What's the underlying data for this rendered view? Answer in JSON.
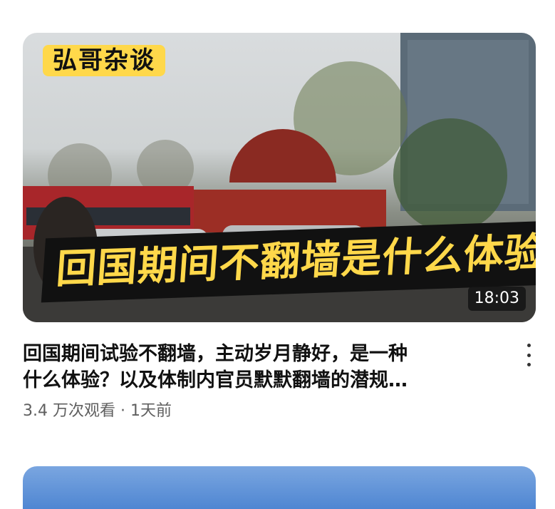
{
  "video": {
    "channel_tag": "弘哥杂谈",
    "overlay_title": "回国期间不翻墙是什么体验",
    "duration": "18:03",
    "title_line1": "回国期间试验不翻墙，主动岁月静好，是一种",
    "title_line2": "什么体验？以及体制内官员默默翻墙的潜规…",
    "views": "3.4 万次观看",
    "separator": "·",
    "age": "1天前",
    "menu_icon": "more-vert-icon"
  }
}
